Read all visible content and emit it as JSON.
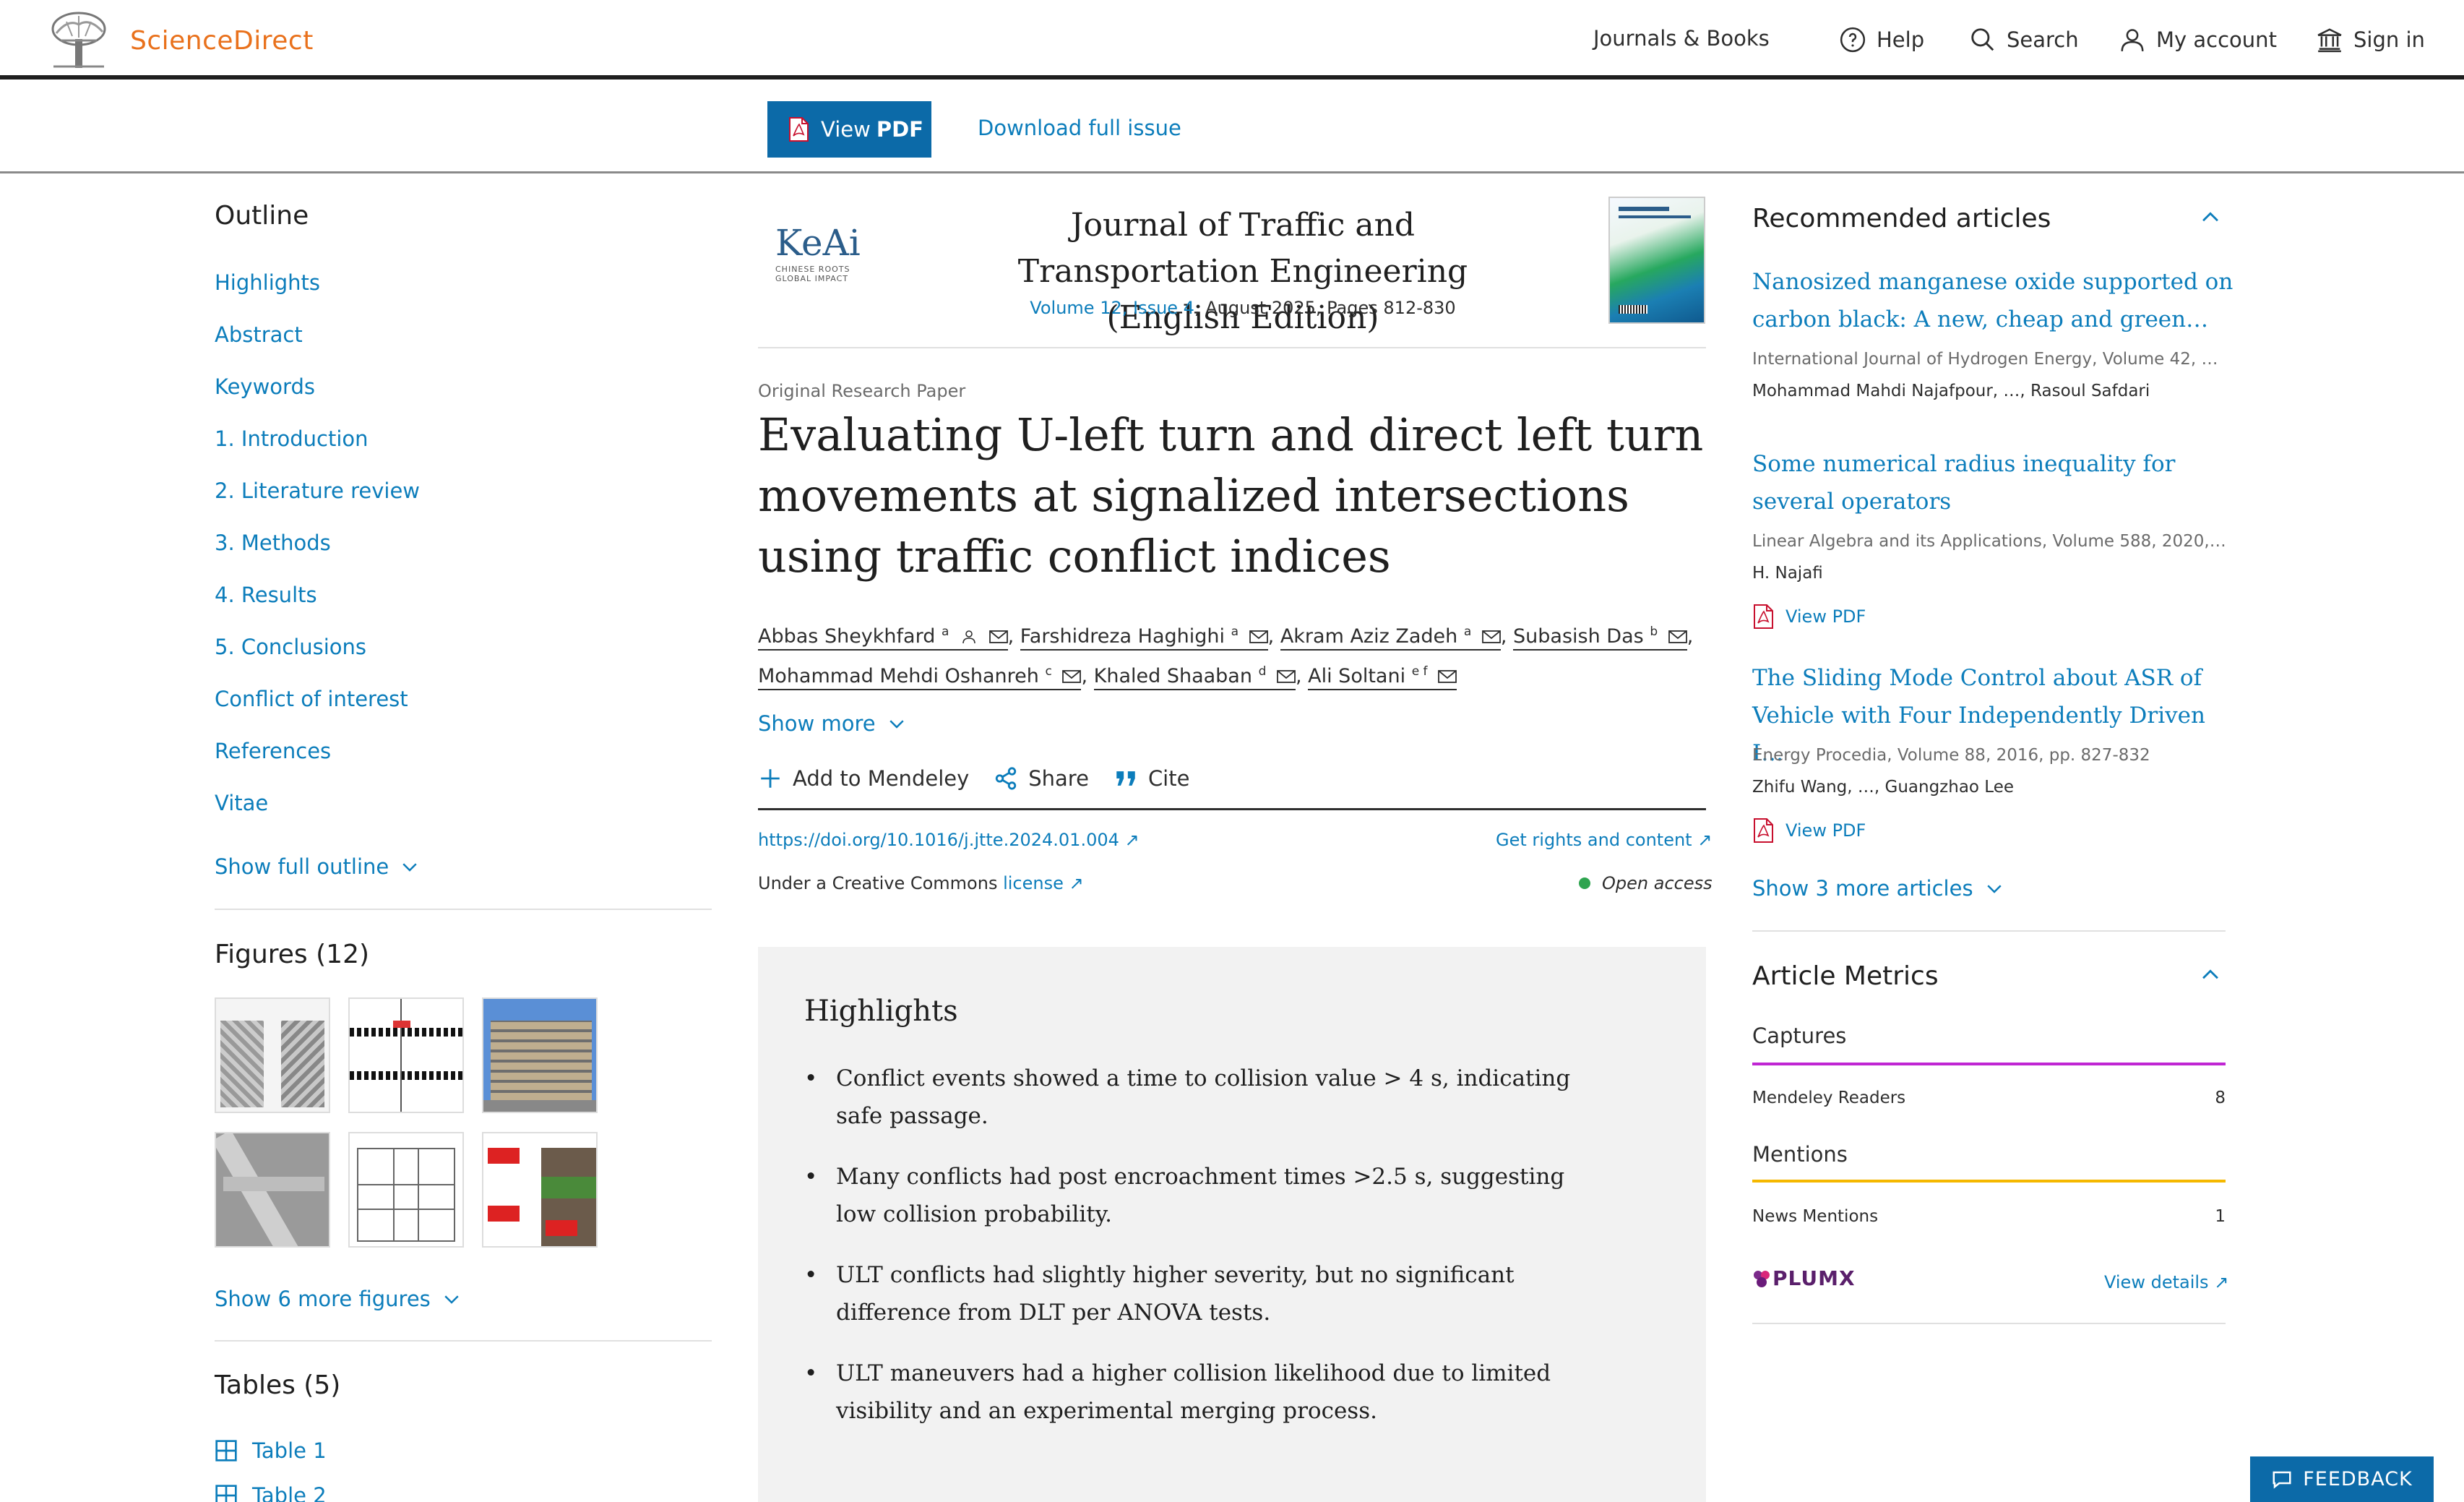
{
  "header": {
    "brand": "ScienceDirect",
    "nav": [
      "Journals & Books",
      "Help",
      "Search",
      "My account",
      "Sign in"
    ]
  },
  "actionbar": {
    "view_pdf_prefix": "View",
    "view_pdf_bold": "PDF",
    "download_issue": "Download full issue"
  },
  "outline": {
    "title": "Outline",
    "items": [
      "Highlights",
      "Abstract",
      "Keywords",
      "1. Introduction",
      "2. Literature review",
      "3. Methods",
      "4. Results",
      "5. Conclusions",
      "Conflict of interest",
      "References",
      "Vitae"
    ],
    "show_full": "Show full outline"
  },
  "figures": {
    "title": "Figures (12)",
    "show_more": "Show 6 more figures"
  },
  "tables": {
    "title": "Tables (5)",
    "items": [
      "Table 1",
      "Table 2"
    ]
  },
  "journal": {
    "publisher_logo": "KeAi",
    "publisher_tagline_1": "CHINESE ROOTS",
    "publisher_tagline_2": "GLOBAL IMPACT",
    "title": "Journal of Traffic and Transportation Engineering (English Edition)",
    "volume_link": "Volume 12, Issue 4",
    "volume_rest": ", August 2025, Pages 812-830"
  },
  "article": {
    "type": "Original Research Paper",
    "title": "Evaluating U-left turn and direct left turn movements at signalized intersections using traffic conflict indices",
    "authors": [
      {
        "name": "Abbas Sheykhfard",
        "sup": "a"
      },
      {
        "name": "Farshidreza Haghighi",
        "sup": "a"
      },
      {
        "name": "Akram Aziz Zadeh",
        "sup": "a"
      },
      {
        "name": "Subasish Das",
        "sup": "b"
      },
      {
        "name": "Mohammad Mehdi Oshanreh",
        "sup": "c"
      },
      {
        "name": "Khaled Shaaban",
        "sup": "d"
      },
      {
        "name": "Ali Soltani",
        "sup": "e f"
      }
    ],
    "show_more": "Show more",
    "tools": [
      "Add to Mendeley",
      "Share",
      "Cite"
    ],
    "doi": "https://doi.org/10.1016/j.jtte.2024.01.004",
    "rights": "Get rights and content",
    "cc_prefix": "Under a Creative Commons",
    "cc_link": "license",
    "open_access": "Open access"
  },
  "highlights": {
    "title": "Highlights",
    "items": [
      "Conflict events showed a time to collision value > 4 s, indicating safe passage.",
      "Many conflicts had post encroachment times >2.5 s, suggesting low collision probability.",
      "ULT conflicts had slightly higher severity, but no significant difference from DLT per ANOVA tests.",
      "ULT maneuvers had a higher collision likelihood due to limited visibility and an experimental merging process."
    ]
  },
  "recommended": {
    "title": "Recommended articles",
    "articles": [
      {
        "title": "Nanosized manganese oxide supported on carbon black: A new, cheap and green…",
        "source": "International Journal of Hydrogen Energy, Volume 42, …",
        "authors": "Mohammad Mahdi Najafpour, …, Rasoul Safdari",
        "pdf": ""
      },
      {
        "title": "Some numerical radius inequality for several operators",
        "source": "Linear Algebra and its Applications, Volume 588, 2020,…",
        "authors": "H. Najafi",
        "pdf": "View PDF"
      },
      {
        "title": "The Sliding Mode Control about ASR of Vehicle with Four Independently Driven I…",
        "source": "Energy Procedia, Volume 88, 2016, pp. 827-832",
        "authors": "Zhifu Wang, …, Guangzhao Lee",
        "pdf": "View PDF"
      }
    ],
    "show_more": "Show 3 more articles"
  },
  "metrics": {
    "title": "Article Metrics",
    "captures_label": "Captures",
    "mendeley_label": "Mendeley Readers",
    "mendeley_value": "8",
    "mentions_label": "Mentions",
    "news_label": "News Mentions",
    "news_value": "1",
    "plumx": "PLUMX",
    "view_details": "View details",
    "captures_color": "#c026d3",
    "mentions_color": "#f5b800"
  },
  "feedback": "FEEDBACK",
  "colors": {
    "accent": "#0c7dbb",
    "brand": "#e9711c",
    "button": "#0c6aa8"
  }
}
